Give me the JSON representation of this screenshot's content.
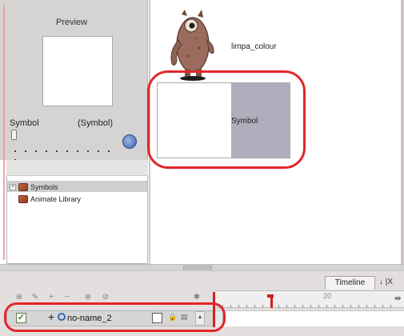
{
  "preview": {
    "title": "Preview",
    "symbol_left": "Symbol",
    "symbol_right": "(Symbol)"
  },
  "tree": {
    "items": [
      {
        "label": "Symbols",
        "icon": "folder-icon"
      },
      {
        "label": "Animate Library",
        "icon": "folder-icon"
      }
    ]
  },
  "library": {
    "item_label": "limpa_colour",
    "symbol_label": "Symbol"
  },
  "timeline": {
    "tab_label": "Timeline",
    "tab_extra": "↓ |X",
    "ruler_number": "20",
    "layer": {
      "name": "no-name_2",
      "checked": "✓"
    }
  },
  "colors": {
    "highlight_ring": "#e3262a",
    "symbol_thumb": "#aeaebd",
    "panel_bg": "#d6d3d3"
  }
}
